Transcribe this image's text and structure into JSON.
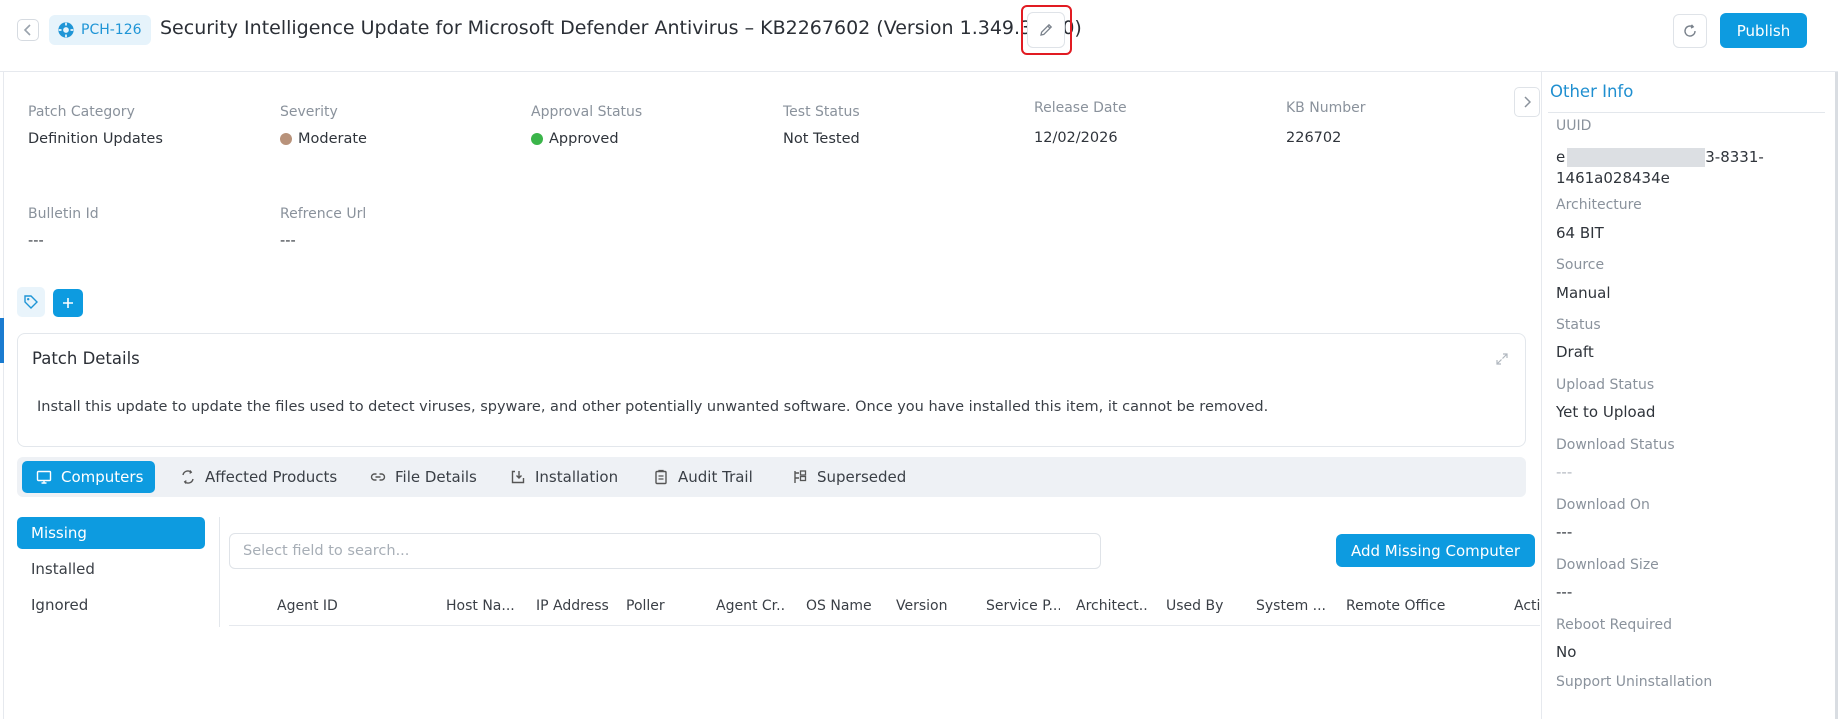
{
  "header": {
    "patch_id": "PCH-126",
    "title": "Security Intelligence Update for Microsoft Defender Antivirus – KB2267602 (Version 1.349.354.0)",
    "publish_label": "Publish"
  },
  "fields": {
    "patch_category": {
      "label": "Patch Category",
      "value": "Definition Updates"
    },
    "severity": {
      "label": "Severity",
      "value": "Moderate",
      "color": "#b8927a"
    },
    "approval_status": {
      "label": "Approval Status",
      "value": "Approved",
      "color": "#3bb54a"
    },
    "test_status": {
      "label": "Test Status",
      "value": "Not Tested"
    },
    "release_date": {
      "label": "Release Date",
      "value": "12/02/2026"
    },
    "kb_number": {
      "label": "KB Number",
      "value": "226702"
    },
    "bulletin_id": {
      "label": "Bulletin Id",
      "value": "---"
    },
    "reference_url": {
      "label": "Refrence Url",
      "value": "---"
    }
  },
  "details": {
    "title": "Patch Details",
    "text": "Install this update to update the files used to detect viruses, spyware, and other potentially unwanted software. Once you have installed this item, it cannot be removed."
  },
  "tabs": [
    {
      "label": "Computers",
      "icon": "monitor-icon",
      "active": true
    },
    {
      "label": "Affected Products",
      "icon": "products-icon"
    },
    {
      "label": "File Details",
      "icon": "link-icon"
    },
    {
      "label": "Installation",
      "icon": "install-icon"
    },
    {
      "label": "Audit Trail",
      "icon": "clipboard-icon"
    },
    {
      "label": "Superseded",
      "icon": "superseded-icon"
    }
  ],
  "sub_nav": [
    {
      "label": "Missing",
      "active": true
    },
    {
      "label": "Installed"
    },
    {
      "label": "Ignored"
    }
  ],
  "search": {
    "placeholder": "Select field to search..."
  },
  "add_missing_label": "Add Missing Computer",
  "table": {
    "columns": [
      "Agent ID",
      "Host Na...",
      "IP Address",
      "Poller",
      "Agent Cr...",
      "OS Name",
      "Version",
      "Service P...",
      "Architect...",
      "Used By",
      "System ...",
      "Remote Office",
      "Acti"
    ]
  },
  "other_info": {
    "title": "Other Info",
    "uuid": {
      "label": "UUID",
      "value_start": "e",
      "value_end": "3-8331-",
      "value_line2": "1461a028434e"
    },
    "architecture": {
      "label": "Architecture",
      "value": "64 BIT"
    },
    "source": {
      "label": "Source",
      "value": "Manual"
    },
    "status": {
      "label": "Status",
      "value": "Draft"
    },
    "upload_status": {
      "label": "Upload Status",
      "value": "Yet to Upload"
    },
    "download_status": {
      "label": "Download Status",
      "value": "---"
    },
    "download_on": {
      "label": "Download On",
      "value": "---"
    },
    "download_size": {
      "label": "Download Size",
      "value": "---"
    },
    "reboot_required": {
      "label": "Reboot Required",
      "value": "No"
    },
    "support_uninstallation": {
      "label": "Support Uninstallation"
    }
  }
}
